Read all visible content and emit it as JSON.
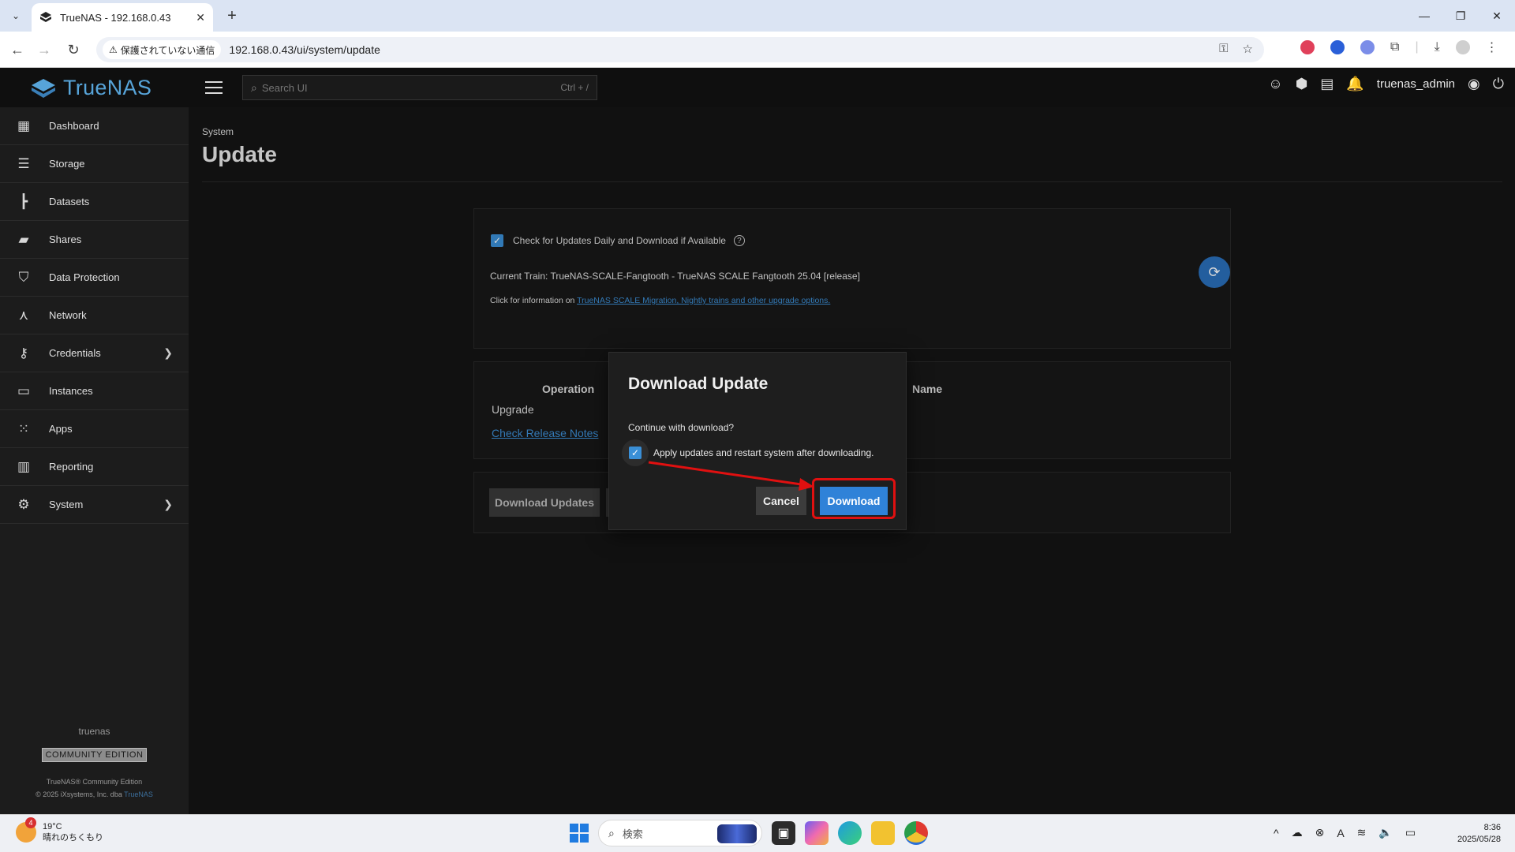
{
  "browser": {
    "tab_title": "TrueNAS - 192.168.0.43",
    "security_label": "保護されていない通信",
    "url": "192.168.0.43/ui/system/update"
  },
  "header": {
    "logo_text": "TrueNAS",
    "search_placeholder": "Search UI",
    "search_shortcut": "Ctrl + /",
    "username": "truenas_admin"
  },
  "sidebar": {
    "items": [
      {
        "label": "Dashboard",
        "icon": "dashboard-icon"
      },
      {
        "label": "Storage",
        "icon": "storage-icon"
      },
      {
        "label": "Datasets",
        "icon": "datasets-icon"
      },
      {
        "label": "Shares",
        "icon": "shares-icon"
      },
      {
        "label": "Data Protection",
        "icon": "shield-icon"
      },
      {
        "label": "Network",
        "icon": "network-icon"
      },
      {
        "label": "Credentials",
        "icon": "key-icon"
      },
      {
        "label": "Instances",
        "icon": "laptop-icon"
      },
      {
        "label": "Apps",
        "icon": "apps-grid-icon"
      },
      {
        "label": "Reporting",
        "icon": "bar-chart-icon"
      },
      {
        "label": "System",
        "icon": "gear-icon"
      }
    ],
    "hostname": "truenas",
    "edition": "COMMUNITY EDITION",
    "copyright_line1": "TrueNAS® Community Edition",
    "copyright_line2": "© 2025 iXsystems, Inc. dba",
    "copyright_link": "TrueNAS"
  },
  "page": {
    "breadcrumb": "System",
    "title": "Update"
  },
  "update_card": {
    "auto_check_label": "Check for Updates Daily and Download if Available",
    "auto_check_checked": true,
    "current_train": "Current Train: TrueNAS-SCALE-Fangtooth - TrueNAS SCALE Fangtooth 25.04 [release]",
    "info_prefix": "Click for information on",
    "info_link": "TrueNAS SCALE Migration, Nightly trains and other upgrade options."
  },
  "pending_table": {
    "col_operation": "Operation",
    "col_name": "Name",
    "operation_value": "Upgrade",
    "release_notes_link": "Check Release Notes"
  },
  "actions": {
    "download_updates_label": "Download Updates"
  },
  "dialog": {
    "title": "Download Update",
    "message": "Continue with download?",
    "apply_label": "Apply updates and restart system after downloading.",
    "apply_checked": true,
    "cancel_label": "Cancel",
    "download_label": "Download"
  },
  "colors": {
    "accent": "#2f82d8",
    "logo": "#57a4d9",
    "annotation": "#e01010"
  },
  "taskbar": {
    "weather_badge": "4",
    "weather_temp": "19°C",
    "weather_desc": "晴れのちくもり",
    "search_text": "検索",
    "time": "8:36",
    "date": "2025/05/28"
  }
}
